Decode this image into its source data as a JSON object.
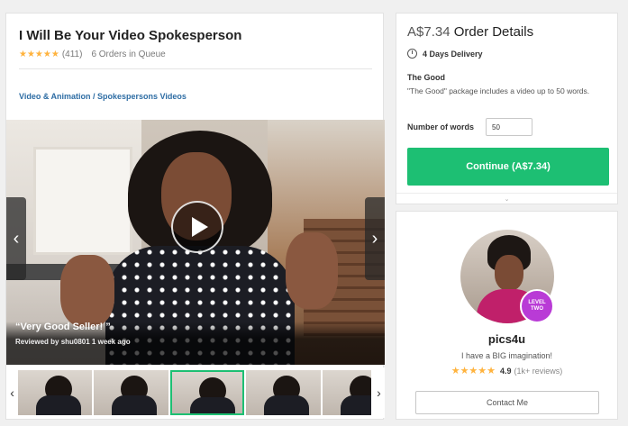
{
  "gig": {
    "title": "I Will Be Your Video Spokesperson",
    "stars": "★★★★★",
    "review_count": "(411)",
    "queue": "6 Orders in Queue",
    "breadcrumb": "Video & Animation / Spokespersons Videos"
  },
  "video": {
    "prev_arrow": "‹",
    "next_arrow": "›",
    "review_quote": "“Very Good   Seller!   ”",
    "review_by": "Reviewed by shu0801 1 week ago"
  },
  "thumbnails": {
    "prev_arrow": "‹",
    "next_arrow": "›",
    "active_index": 2,
    "count": 5
  },
  "order": {
    "price": "A$7.34",
    "title": "Order Details",
    "delivery": "4 Days Delivery",
    "package_name": "The Good",
    "package_desc": "\"The Good\" package includes a video up to 50 words.",
    "words_label": "Number of words",
    "words_value": "50",
    "continue_label": "Continue (A$7.34)",
    "expand_icon": "⌄"
  },
  "seller": {
    "name": "pics4u",
    "tagline": "I have a BIG imagination!",
    "level_line1": "LEVEL",
    "level_line2": "TWO",
    "stars": "★★★★★",
    "score": "4.9",
    "reviews": "(1k+ reviews)",
    "contact_label": "Contact Me"
  },
  "colors": {
    "accent_green": "#1dbf73",
    "star_yellow": "#ffb33e",
    "link_blue": "#2e6da4",
    "level_purple": "#b93bd6"
  }
}
